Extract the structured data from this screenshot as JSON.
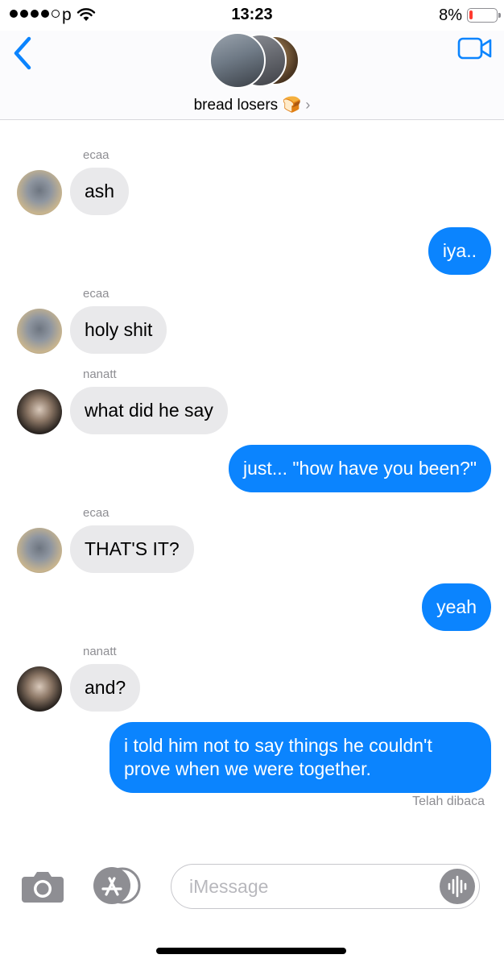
{
  "status_bar": {
    "carrier": "p",
    "time": "13:23",
    "battery": "8%",
    "battery_level": 0.08
  },
  "header": {
    "group_name": "bread losers 🍞",
    "chevron": "›"
  },
  "messages": {
    "m1_sender": "ecaa",
    "m1_text": "ash",
    "m2_text": "iya..",
    "m3_sender": "ecaa",
    "m3_text": "holy shit",
    "m4_sender": "nanatt",
    "m4_text": "what did he say",
    "m5_text": "just... \"how have you been?\"",
    "m6_sender": "ecaa",
    "m6_text": "THAT'S IT?",
    "m7_text": "yeah",
    "m8_sender": "nanatt",
    "m8_text": "and?",
    "m9_text": "i told him not to say things he couldn't prove when we were together."
  },
  "read_receipt": "Telah dibaca",
  "composer": {
    "placeholder": "iMessage"
  },
  "colors": {
    "outgoing": "#0b84fe",
    "incoming": "#e9e9eb",
    "accent": "#0b84fe"
  },
  "icons": [
    "signal-dots-icon",
    "wifi-icon",
    "battery-icon",
    "back-chevron-icon",
    "facetime-video-icon",
    "camera-icon",
    "app-store-icon",
    "audio-message-icon"
  ]
}
